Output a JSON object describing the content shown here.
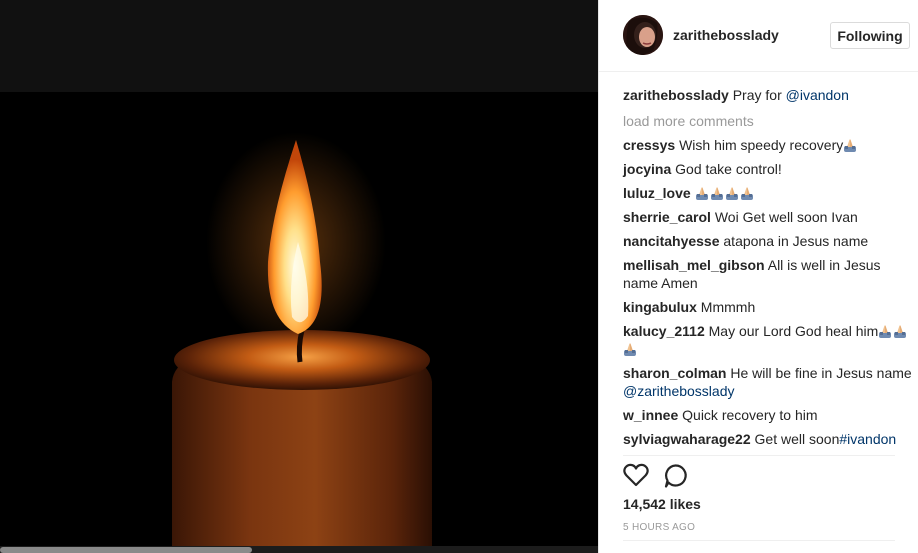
{
  "post": {
    "owner": "zarithebosslady",
    "follow_button": "Following",
    "caption": {
      "user": "zarithebosslady",
      "text": "Pray for ",
      "mention": "@ivandon"
    },
    "load_more": "load more comments",
    "likes": "14,542 likes",
    "timestamp": "5 HOURS AGO"
  },
  "comments": [
    {
      "user": "cressys",
      "text": "Wish him speedy recovery",
      "emoji_count": 1
    },
    {
      "user": "jocyina",
      "text": "God take control!",
      "emoji_count": 0
    },
    {
      "user": "luluz_love",
      "text": "",
      "emoji_count": 4
    },
    {
      "user": "sherrie_carol",
      "text": "Woi Get well soon Ivan",
      "emoji_count": 0
    },
    {
      "user": "nancitahyesse",
      "text": "atapona in Jesus name",
      "emoji_count": 0
    },
    {
      "user": "mellisah_mel_gibson",
      "text": "All is well in Jesus name Amen",
      "emoji_count": 0
    },
    {
      "user": "kingabulux",
      "text": "Mmmmh",
      "emoji_count": 0
    },
    {
      "user": "kalucy_2112",
      "text": "May our Lord God heal him",
      "emoji_count": 3
    },
    {
      "user": "sharon_colman",
      "text": "He will be fine in Jesus name ",
      "mention": "@zarithebosslady",
      "emoji_count": 0
    },
    {
      "user": "w_innee",
      "text": "Quick recovery to him",
      "emoji_count": 0
    },
    {
      "user": "sylviagwaharage22",
      "text": "Get well soon",
      "mention": "#ivandon",
      "emoji_count": 0
    }
  ],
  "icons": {
    "like": "heart-icon",
    "comment": "comment-icon",
    "emoji": "praying-hands-emoji"
  }
}
